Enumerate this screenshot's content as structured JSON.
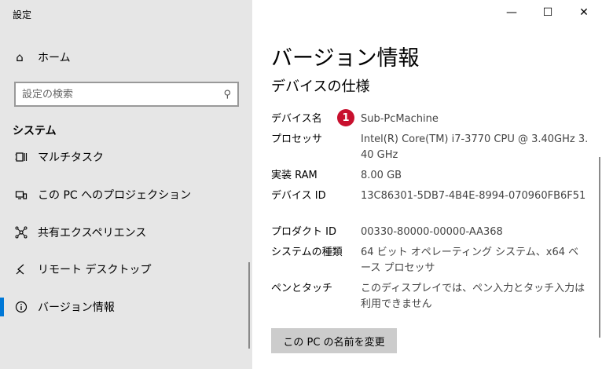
{
  "app": {
    "title": "設定"
  },
  "sidebar": {
    "home": {
      "label": "ホーム",
      "icon": "home-icon"
    },
    "search": {
      "placeholder": "設定の検索",
      "icon": "search-icon"
    },
    "section_label": "システム",
    "items": [
      {
        "label": "マルチタスク",
        "icon": "multitasking-icon"
      },
      {
        "label": "この PC へのプロジェクション",
        "icon": "projection-icon"
      },
      {
        "label": "共有エクスペリエンス",
        "icon": "shared-experiences-icon"
      },
      {
        "label": "リモート デスクトップ",
        "icon": "remote-desktop-icon"
      },
      {
        "label": "バージョン情報",
        "icon": "info-icon",
        "active": true
      }
    ]
  },
  "window_controls": {
    "minimize": "—",
    "maximize": "☐",
    "close": "✕"
  },
  "main": {
    "title": "バージョン情報",
    "section_title": "デバイスの仕様",
    "badge": "1",
    "specs": [
      {
        "label": "デバイス名",
        "value": "Sub-PcMachine"
      },
      {
        "label": "プロセッサ",
        "value": "Intel(R) Core(TM) i7-3770 CPU @ 3.40GHz 3.40 GHz"
      },
      {
        "label": "実装 RAM",
        "value": "8.00 GB"
      },
      {
        "label": "デバイス ID",
        "value": "13C86301-5DB7-4B4E-8994-070960FB6F51"
      },
      {
        "label": "プロダクト ID",
        "value": "00330-80000-00000-AA368"
      },
      {
        "label": "システムの種類",
        "value": "64 ビット オペレーティング システム、x64 ベース プロセッサ"
      },
      {
        "label": "ペンとタッチ",
        "value": "このディスプレイでは、ペン入力とタッチ入力は利用できません"
      }
    ],
    "rename_button": "この PC の名前を変更"
  },
  "colors": {
    "accent": "#0078d7",
    "badge": "#c8102e",
    "sidebar_bg": "#e6e6e6"
  }
}
